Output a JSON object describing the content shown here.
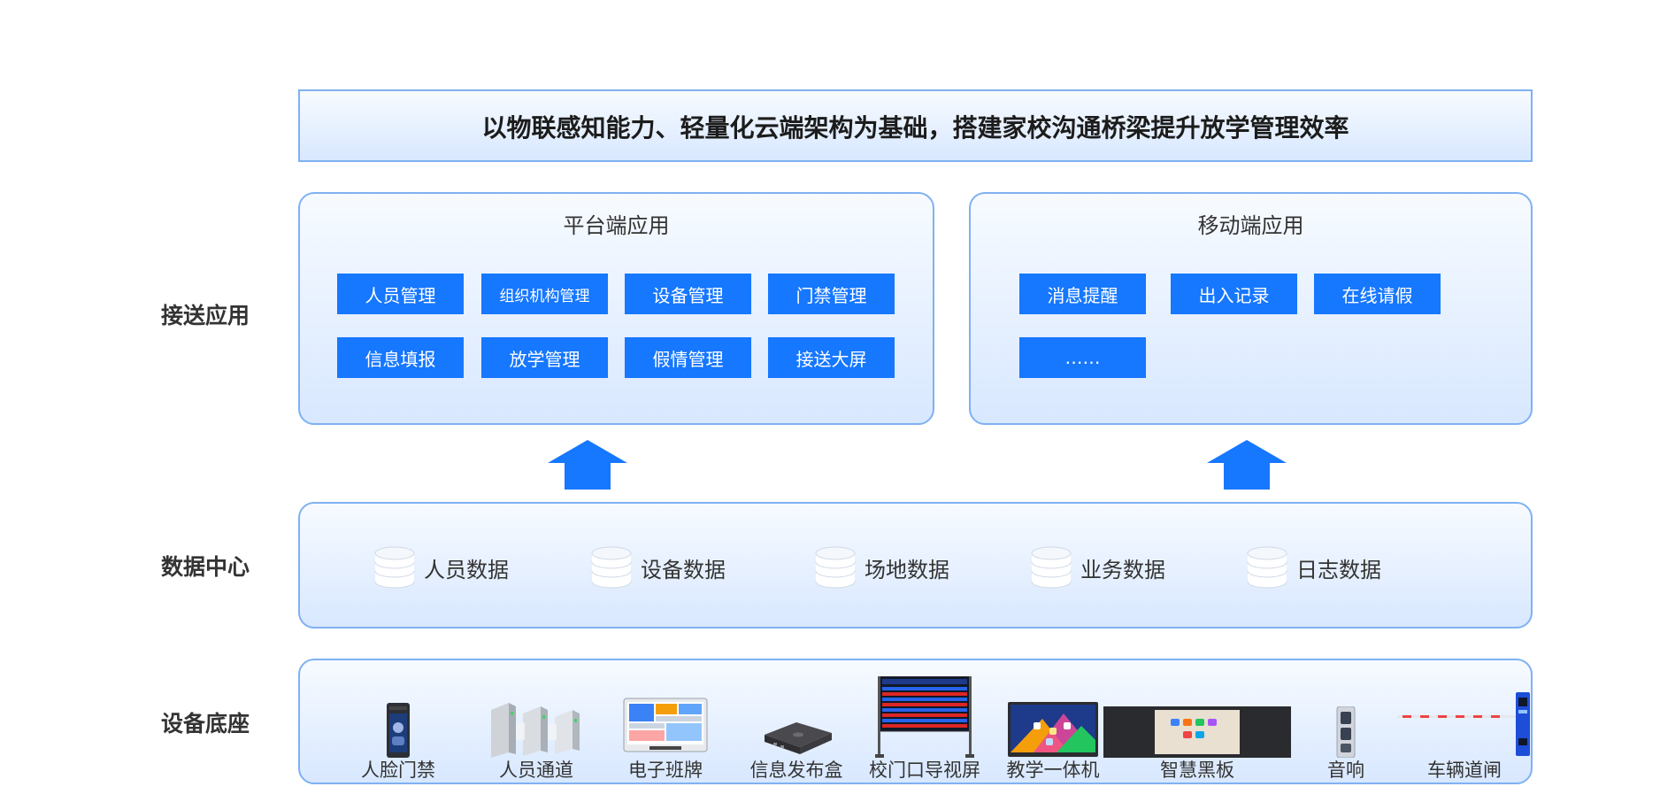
{
  "headline": "以物联感知能力、轻量化云端架构为基础，搭建家校沟通桥梁提升放学管理效率",
  "rows": {
    "app": "接送应用",
    "data": "数据中心",
    "device": "设备底座"
  },
  "platform": {
    "title": "平台端应用",
    "items": [
      "人员管理",
      "组织机构管理",
      "设备管理",
      "门禁管理",
      "信息填报",
      "放学管理",
      "假情管理",
      "接送大屏"
    ]
  },
  "mobile": {
    "title": "移动端应用",
    "items": [
      "消息提醒",
      "出入记录",
      "在线请假",
      "……"
    ]
  },
  "data_center": {
    "items": [
      "人员数据",
      "设备数据",
      "场地数据",
      "业务数据",
      "日志数据"
    ]
  },
  "devices": {
    "items": [
      "人脸门禁",
      "人员通道",
      "电子班牌",
      "信息发布盒",
      "校门口导视屏",
      "教学一体机",
      "智慧黑板",
      "音响",
      "车辆道闸"
    ]
  },
  "colors": {
    "accent": "#1677ff",
    "panel_border": "#7fb1f2",
    "panel_bg": "#e6f0ff"
  }
}
